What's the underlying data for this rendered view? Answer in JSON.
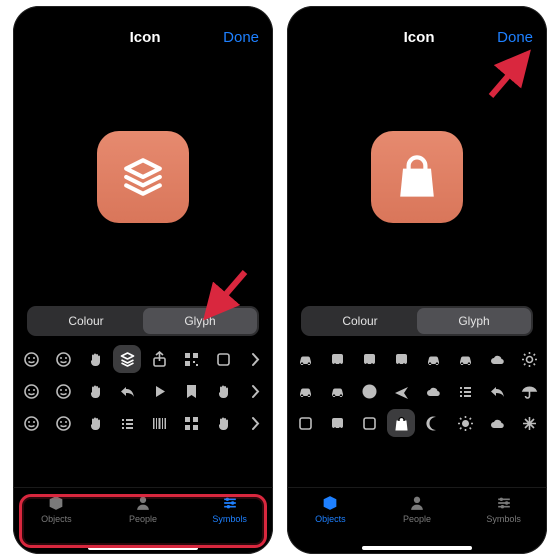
{
  "header": {
    "title": "Icon",
    "done": "Done"
  },
  "segments": {
    "colour": "Colour",
    "glyph": "Glyph"
  },
  "tabs": {
    "objects": "Objects",
    "people": "People",
    "symbols": "Symbols"
  },
  "left": {
    "preview_glyph": "layers",
    "selected_tab": "symbols",
    "selected_glyph_index": 3,
    "glyph_rows": [
      [
        "alien",
        "smile",
        "peace",
        "layers",
        "share",
        "qr",
        "square",
        "chev-right"
      ],
      [
        "grin",
        "love",
        "horns",
        "reply",
        "play",
        "bookmark",
        "palm",
        "chev-right"
      ],
      [
        "neutral",
        "sleep",
        "fist",
        "list",
        "barcode",
        "grid",
        "stop",
        "chev-right"
      ]
    ],
    "annotation_arrow": "points at Glyph segment",
    "annotation_ring": "around bottom tabs"
  },
  "right": {
    "preview_glyph": "shopping-bag",
    "selected_tab": "objects",
    "selected_glyph_index": 19,
    "glyph_rows": [
      [
        "car",
        "bus",
        "train",
        "tram",
        "scooter",
        "truck",
        "ship",
        "gear"
      ],
      [
        "motorbike",
        "bike",
        "relay",
        "plane",
        "boat",
        "cutlery",
        "hanger",
        "umbrella"
      ],
      [
        "fuel",
        "metro",
        "sign",
        "bag",
        "moon",
        "sun",
        "cloud",
        "snow"
      ]
    ],
    "annotation_arrow": "points at Done"
  },
  "colors": {
    "accent": "#1e80ff",
    "icon_bg": "#e68a6f",
    "highlight": "#d9273e"
  }
}
